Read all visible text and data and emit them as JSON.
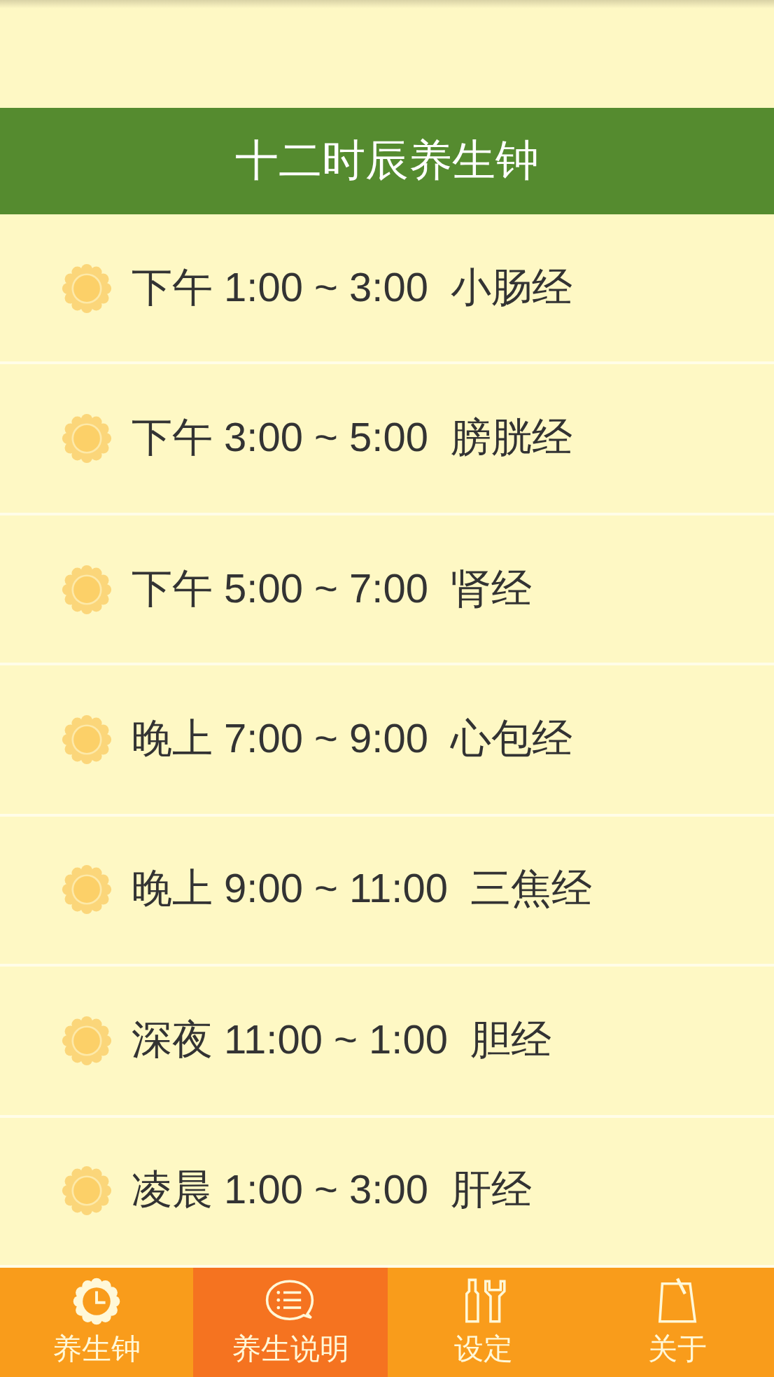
{
  "header": {
    "title": "十二时辰养生钟"
  },
  "rows": [
    {
      "period": "下午",
      "time": "1:00 ~ 3:00",
      "meridian": "小肠经"
    },
    {
      "period": "下午",
      "time": "3:00 ~ 5:00",
      "meridian": "膀胱经"
    },
    {
      "period": "下午",
      "time": "5:00 ~ 7:00",
      "meridian": "肾经"
    },
    {
      "period": "晚上",
      "time": "7:00 ~ 9:00",
      "meridian": "心包经"
    },
    {
      "period": "晚上",
      "time": "9:00 ~ 11:00",
      "meridian": "三焦经"
    },
    {
      "period": "深夜",
      "time": "11:00 ~ 1:00",
      "meridian": "胆经"
    },
    {
      "period": "凌晨",
      "time": "1:00 ~ 3:00",
      "meridian": "肝经"
    }
  ],
  "tabs": [
    {
      "label": "养生钟",
      "kind": "clock",
      "selected": false
    },
    {
      "label": "养生说明",
      "kind": "chat",
      "selected": true
    },
    {
      "label": "设定",
      "kind": "tools",
      "selected": false
    },
    {
      "label": "关于",
      "kind": "note",
      "selected": false
    }
  ]
}
